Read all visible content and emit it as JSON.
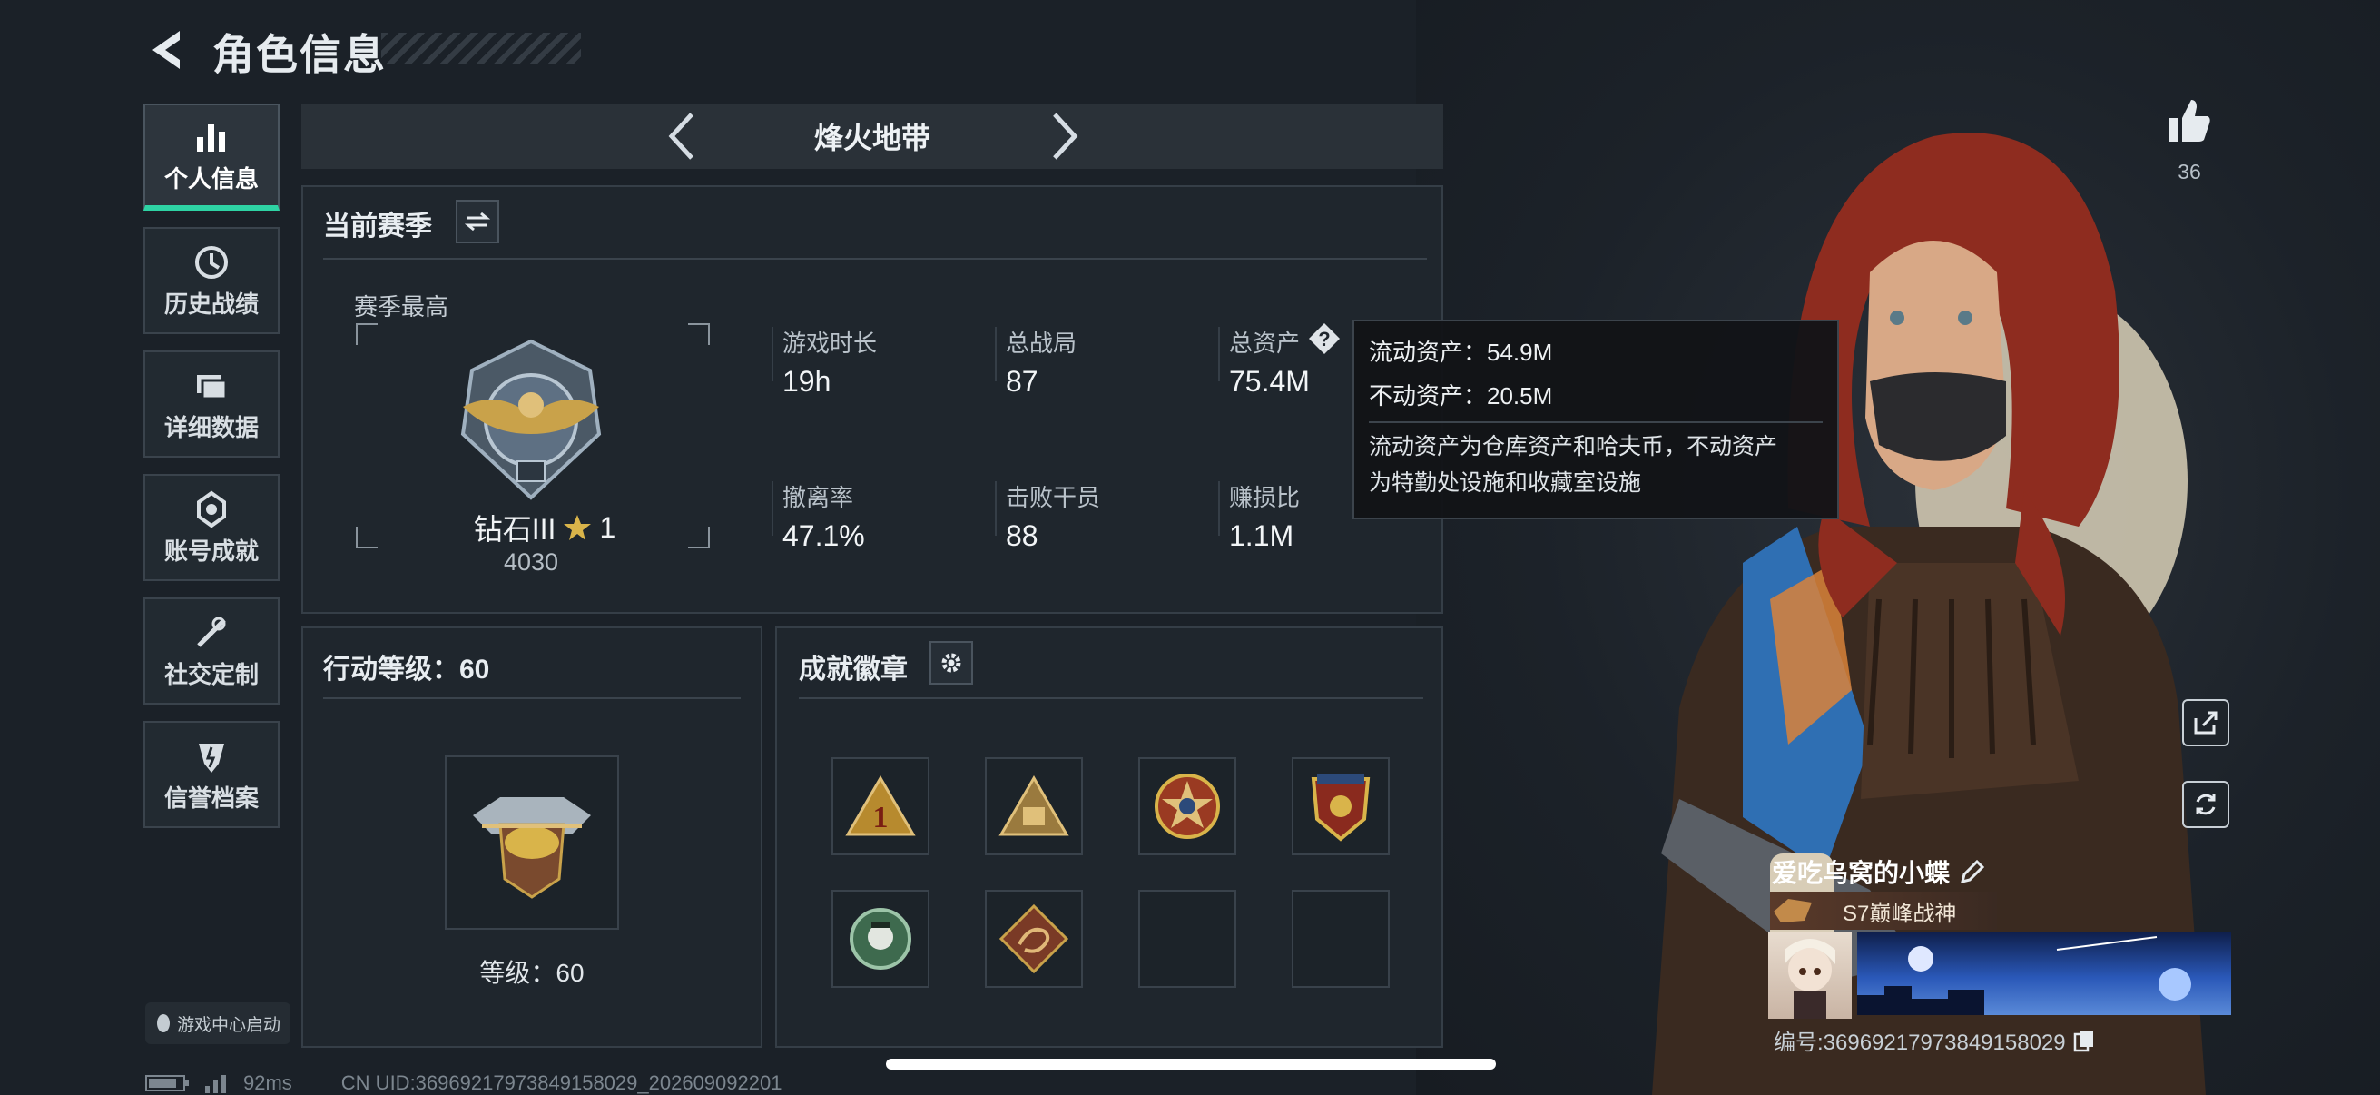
{
  "header": {
    "title": "角色信息"
  },
  "nav": {
    "items": [
      {
        "label": "个人信息"
      },
      {
        "label": "历史战绩"
      },
      {
        "label": "详细数据"
      },
      {
        "label": "账号成就"
      },
      {
        "label": "社交定制"
      },
      {
        "label": "信誉档案"
      }
    ],
    "game_center": "游戏中心启动"
  },
  "mode": {
    "name": "烽火地带"
  },
  "season": {
    "title": "当前赛季",
    "best_label": "赛季最高",
    "rank_name": "钻石III",
    "rank_stars": "1",
    "rank_score": "4030",
    "stats": [
      {
        "label": "游戏时长",
        "value": "19h"
      },
      {
        "label": "总战局",
        "value": "87"
      },
      {
        "label": "总资产",
        "value": "75.4M"
      },
      {
        "label": "撤离率",
        "value": "47.1%"
      },
      {
        "label": "击败干员",
        "value": "88"
      },
      {
        "label": "赚损比",
        "value": "1.1M"
      }
    ]
  },
  "tooltip": {
    "liquid": "流动资产：54.9M",
    "fixed": "不动资产：20.5M",
    "desc_line1": "流动资产为仓库资产和哈夫币，不动资产",
    "desc_line2": "为特勤处设施和收藏室设施"
  },
  "action_level": {
    "title": "行动等级：60",
    "level_text": "等级：60"
  },
  "achievements": {
    "title": "成就徽章"
  },
  "profile": {
    "likes": "36",
    "nickname": "爱吃乌窝的小蝶",
    "title_badge": "S7巅峰战神",
    "id_text": "编号:36969217973849158029"
  },
  "status_bar": {
    "ping": "92ms",
    "uid": "CN UID:36969217973849158029_202609092201"
  },
  "colors": {
    "accent": "#2ed3a4",
    "gold": "#c9a24a"
  }
}
